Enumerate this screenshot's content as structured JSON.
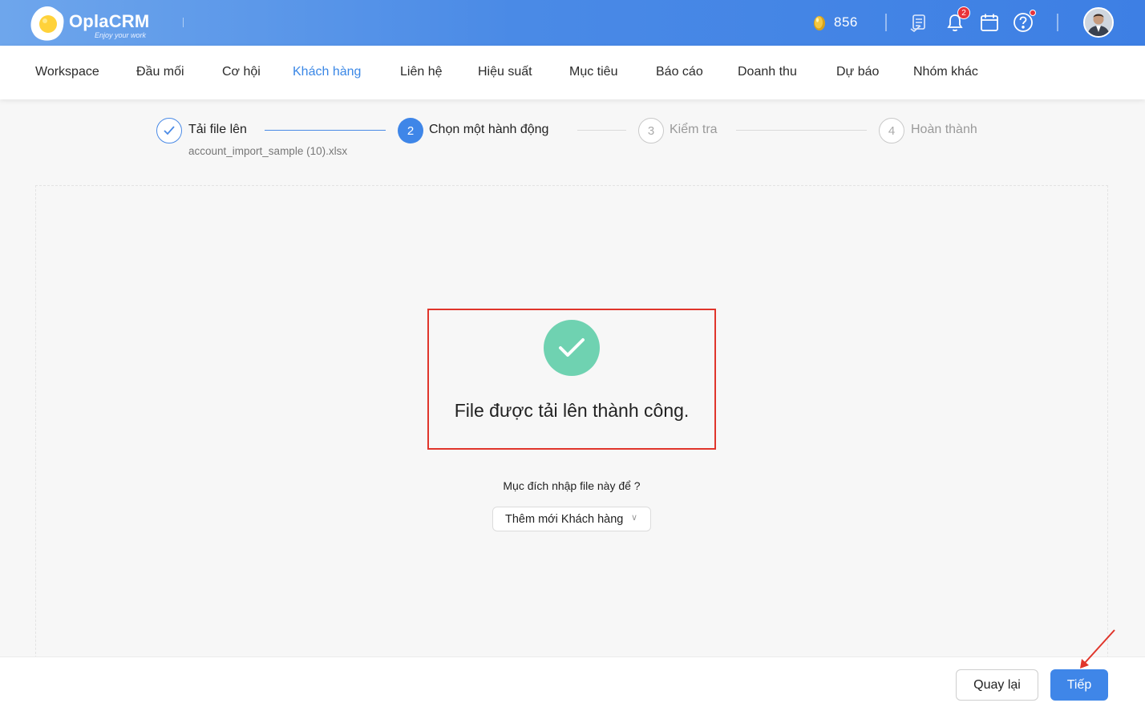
{
  "header": {
    "app_name": "OplaCRM",
    "tagline": "Enjoy your work",
    "coins": "856",
    "notification_count": "2"
  },
  "nav": {
    "items": [
      {
        "label": "Workspace"
      },
      {
        "label": "Đầu mối"
      },
      {
        "label": "Cơ hội"
      },
      {
        "label": "Khách hàng"
      },
      {
        "label": "Liên hệ"
      },
      {
        "label": "Hiệu suất"
      },
      {
        "label": "Mục tiêu"
      },
      {
        "label": "Báo cáo"
      },
      {
        "label": "Doanh thu"
      },
      {
        "label": "Dự báo"
      },
      {
        "label": "Nhóm khác"
      }
    ],
    "active": "Khách hàng"
  },
  "stepper": {
    "steps": [
      {
        "number": "1",
        "label": "Tải file lên",
        "state": "done"
      },
      {
        "number": "2",
        "label": "Chọn một hành động",
        "state": "active"
      },
      {
        "number": "3",
        "label": "Kiểm tra",
        "state": "pending"
      },
      {
        "number": "4",
        "label": "Hoàn thành",
        "state": "pending"
      }
    ],
    "uploaded_file": "account_import_sample (10).xlsx"
  },
  "main": {
    "success_message": "File được tải lên thành công.",
    "purpose_label": "Mục đích nhập file này để ?",
    "purpose_select_value": "Thêm mới Khách hàng"
  },
  "footer": {
    "back_label": "Quay lại",
    "next_label": "Tiếp"
  },
  "colors": {
    "header_gradient_start": "#6ea6ec",
    "header_gradient_end": "#3d7fe4",
    "accent": "#3f86e8",
    "success": "#6fd2b1",
    "highlight_border": "#e0352b",
    "badge": "#e8333a"
  },
  "icons": [
    "egg-logo-icon",
    "coin-icon",
    "checklist-icon",
    "bell-icon",
    "calendar-icon",
    "help-icon",
    "check-icon",
    "chevron-down-icon",
    "red-arrow-annotation"
  ]
}
